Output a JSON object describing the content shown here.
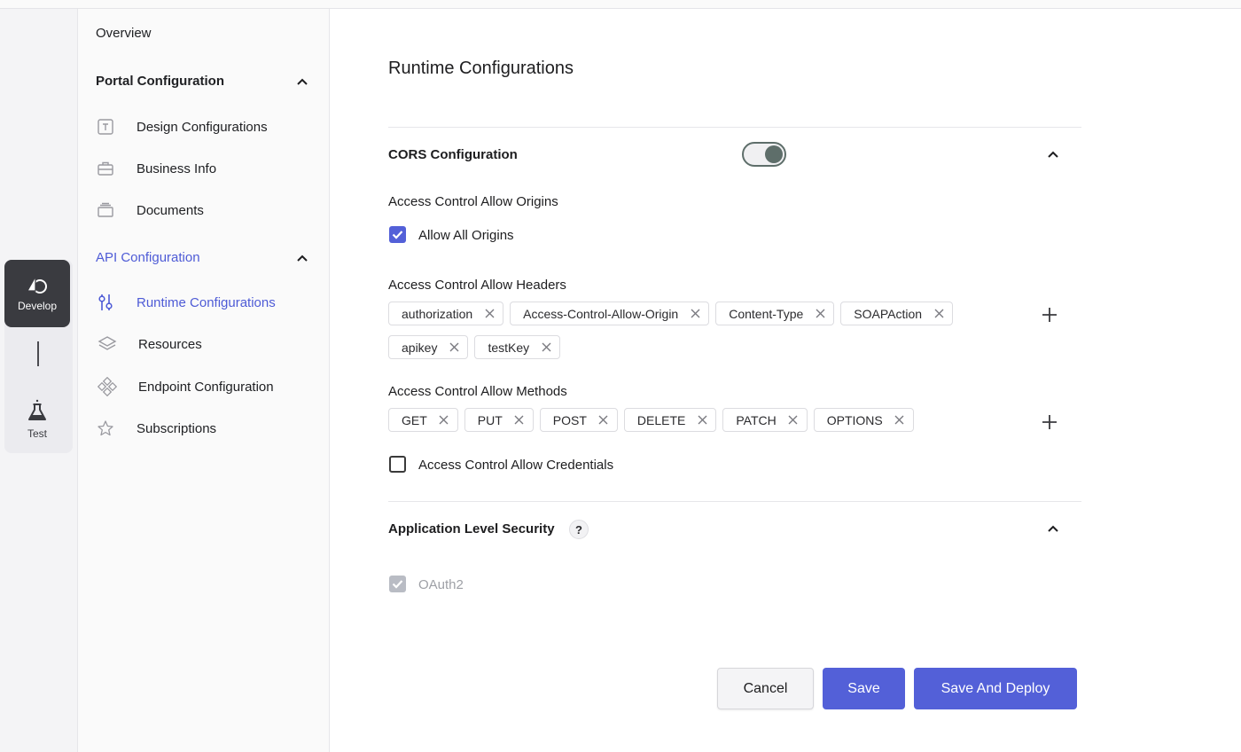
{
  "rail": {
    "develop_label": "Develop",
    "test_label": "Test"
  },
  "sidebar": {
    "overview": "Overview",
    "portal_config": {
      "title": "Portal Configuration",
      "items": [
        "Design Configurations",
        "Business Info",
        "Documents"
      ]
    },
    "api_config": {
      "title": "API Configuration",
      "items": [
        "Runtime Configurations",
        "Resources",
        "Endpoint Configuration",
        "Subscriptions"
      ]
    }
  },
  "main": {
    "page_title": "Runtime Configurations",
    "cors": {
      "title": "CORS Configuration",
      "enabled": true,
      "allow_origins_label": "Access Control Allow Origins",
      "allow_all_origins_label": "Allow All Origins",
      "allow_all_origins_checked": true,
      "allow_headers_label": "Access Control Allow Headers",
      "headers": [
        "authorization",
        "Access-Control-Allow-Origin",
        "Content-Type",
        "SOAPAction",
        "apikey",
        "testKey"
      ],
      "allow_methods_label": "Access Control Allow Methods",
      "methods": [
        "GET",
        "PUT",
        "POST",
        "DELETE",
        "PATCH",
        "OPTIONS"
      ],
      "allow_credentials_label": "Access Control Allow Credentials",
      "allow_credentials_checked": false
    },
    "security": {
      "title": "Application Level Security",
      "help": "?",
      "oauth2_label": "OAuth2"
    },
    "buttons": {
      "cancel": "Cancel",
      "save": "Save",
      "save_and_deploy": "Save And Deploy"
    }
  },
  "colors": {
    "accent": "#5360d8",
    "active_nav": "#4e5bd6",
    "rail_active": "#3a3b40"
  }
}
